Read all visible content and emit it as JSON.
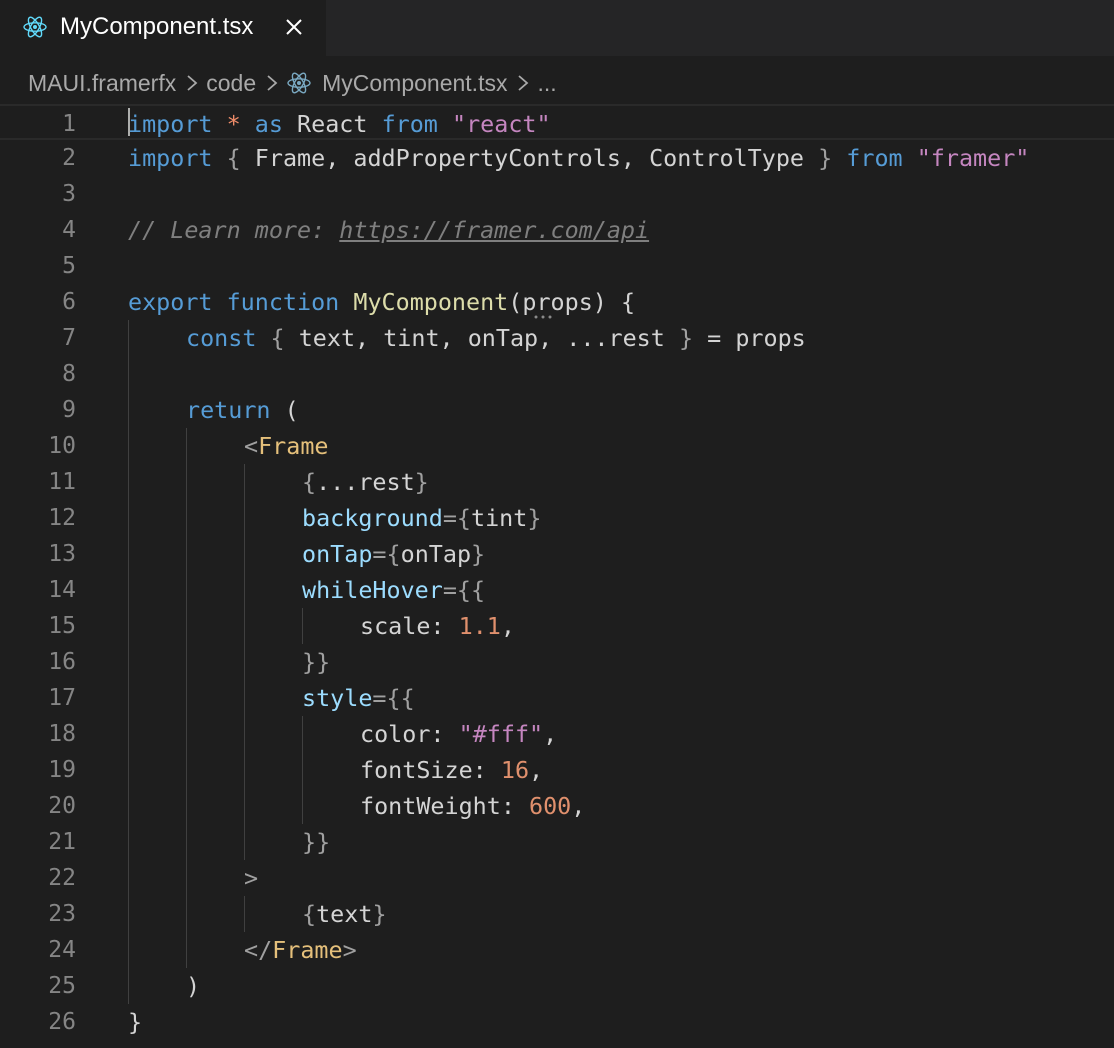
{
  "tab": {
    "label": "MyComponent.tsx",
    "icon": "react-icon",
    "close_icon": "close-icon"
  },
  "breadcrumb": {
    "root": "MAUI.framerfx",
    "folder": "code",
    "file": "MyComponent.tsx",
    "more": "..."
  },
  "line_numbers": [
    "1",
    "2",
    "3",
    "4",
    "5",
    "6",
    "7",
    "8",
    "9",
    "10",
    "11",
    "12",
    "13",
    "14",
    "15",
    "16",
    "17",
    "18",
    "19",
    "20",
    "21",
    "22",
    "23",
    "24",
    "25",
    "26"
  ],
  "code": {
    "l1": {
      "kw1": "import",
      "op": "*",
      "kw2": "as",
      "name": "React",
      "kw3": "from",
      "str": "\"react\""
    },
    "l2": {
      "kw1": "import",
      "open": "{",
      "names": "Frame, addPropertyControls, ControlType",
      "close": "}",
      "kw2": "from",
      "str": "\"framer\""
    },
    "l4": {
      "comment": "// Learn more: ",
      "link": "https://framer.com/api"
    },
    "l6": {
      "kw1": "export",
      "kw2": "function",
      "fn": "MyComponent",
      "open": "(",
      "param": "props",
      "close": ")",
      "brace": "{"
    },
    "l7": {
      "kw": "const",
      "open": "{",
      "names": "text, tint, onTap, ...rest",
      "close": "}",
      "eq": "=",
      "val": "props"
    },
    "l9": {
      "kw": "return",
      "paren": "("
    },
    "l10": {
      "lt": "<",
      "tag": "Frame"
    },
    "l11": {
      "open": "{",
      "spread": "...rest",
      "close": "}"
    },
    "l12": {
      "attr": "background",
      "eq": "=",
      "open": "{",
      "val": "tint",
      "close": "}"
    },
    "l13": {
      "attr": "onTap",
      "eq": "=",
      "open": "{",
      "val": "onTap",
      "close": "}"
    },
    "l14": {
      "attr": "whileHover",
      "eq": "=",
      "open": "{{"
    },
    "l15": {
      "key": "scale",
      "colon": ":",
      "num": "1.1",
      "comma": ","
    },
    "l16": {
      "close": "}}"
    },
    "l17": {
      "attr": "style",
      "eq": "=",
      "open": "{{"
    },
    "l18": {
      "key": "color",
      "colon": ":",
      "str": "\"#fff\"",
      "comma": ","
    },
    "l19": {
      "key": "fontSize",
      "colon": ":",
      "num": "16",
      "comma": ","
    },
    "l20": {
      "key": "fontWeight",
      "colon": ":",
      "num": "600",
      "comma": ","
    },
    "l21": {
      "close": "}}"
    },
    "l22": {
      "gt": ">"
    },
    "l23": {
      "open": "{",
      "val": "text",
      "close": "}"
    },
    "l24": {
      "lt": "</",
      "tag": "Frame",
      "gt": ">"
    },
    "l25": {
      "paren": ")"
    },
    "l26": {
      "brace": "}"
    }
  },
  "colors": {
    "background": "#1e1e1e",
    "tabbar": "#252526",
    "keyword": "#569cd6",
    "string": "#c586c0",
    "function": "#dcdcaa",
    "component": "#e5c07b",
    "number": "#e0906d",
    "attribute": "#9cdcfe",
    "comment": "#7f7f7f"
  }
}
